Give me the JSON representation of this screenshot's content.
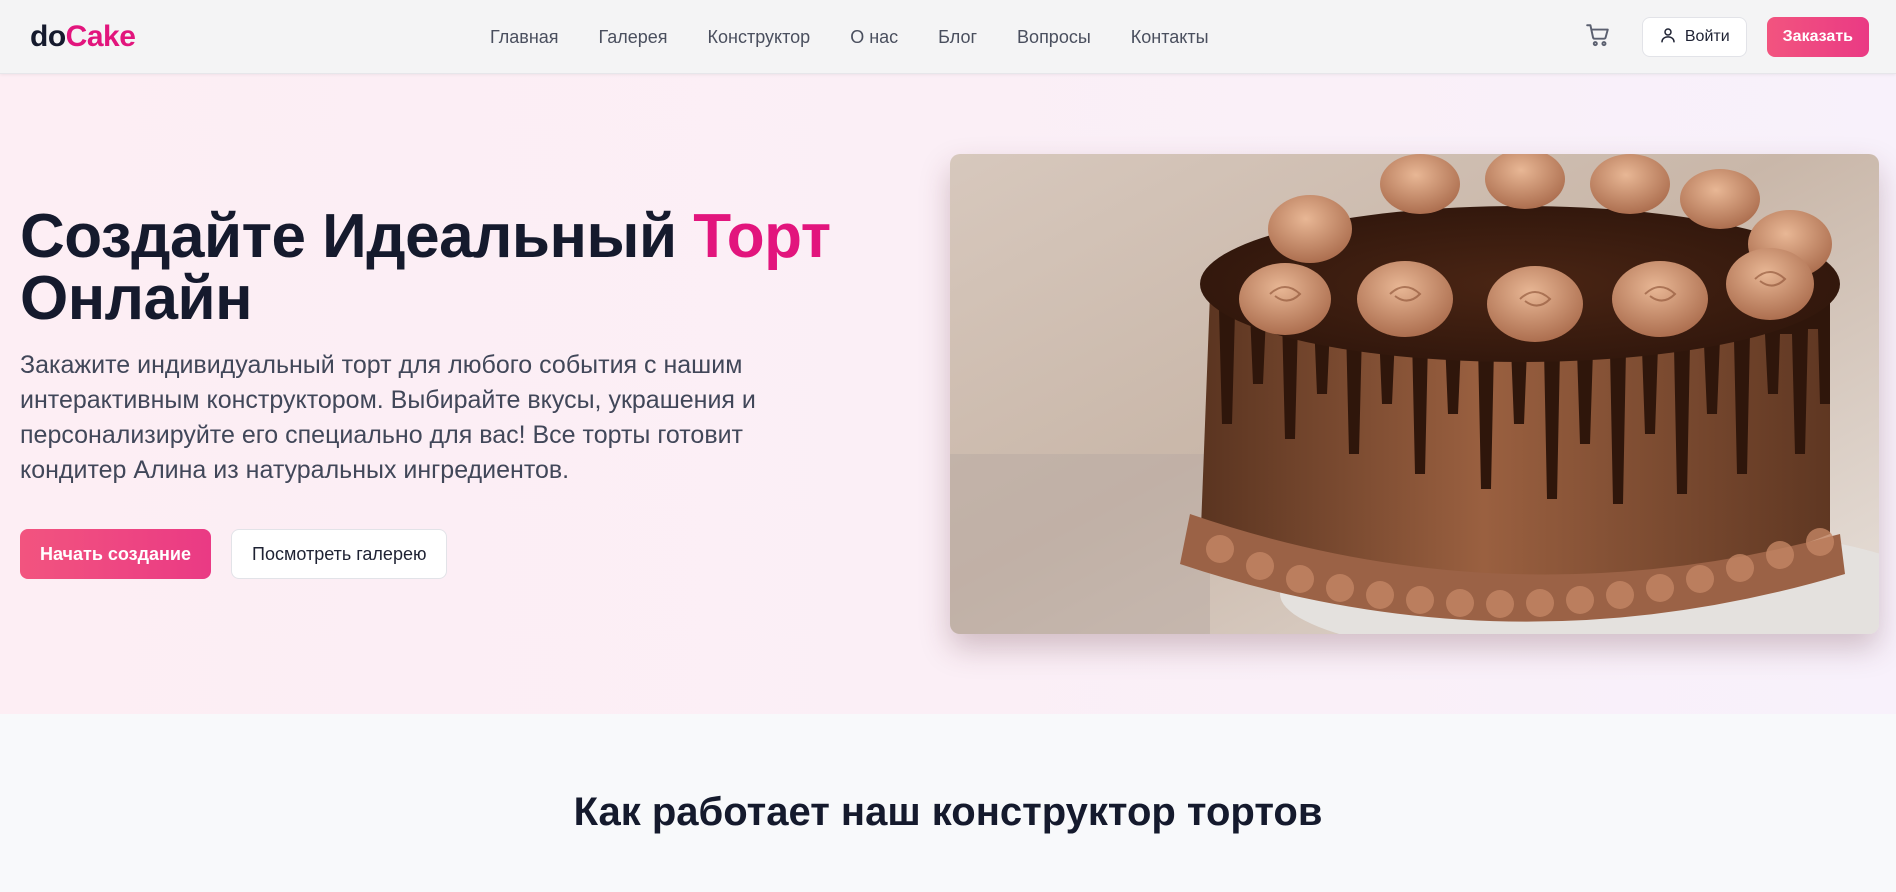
{
  "brand": {
    "part1": "do",
    "part2": "Cake",
    "accent_color": "#e2157d"
  },
  "nav": {
    "items": [
      "Главная",
      "Галерея",
      "Конструктор",
      "О нас",
      "Блог",
      "Вопросы",
      "Контакты"
    ]
  },
  "header_actions": {
    "cart_icon": "shopping-cart-icon",
    "login_icon": "user-icon",
    "login_label": "Войти",
    "order_label": "Заказать"
  },
  "hero": {
    "title_part1": "Создайте Идеальный ",
    "title_accent": "Торт",
    "title_part2": "Онлайн",
    "description": "Закажите индивидуальный торт для любого события с нашим интерактивным конструктором. Выбирайте вкусы, украшения и персонализируйте его специально для вас! Все торты готовит кондитер Алина из натуральных ингредиентов.",
    "primary_button": "Начать создание",
    "secondary_button": "Посмотреть галерею",
    "image_subject": "chocolate drip cake with chocolate cream rosettes",
    "primary_color": "#ea3a84"
  },
  "how_it_works": {
    "title": "Как работает наш конструктор тортов"
  }
}
